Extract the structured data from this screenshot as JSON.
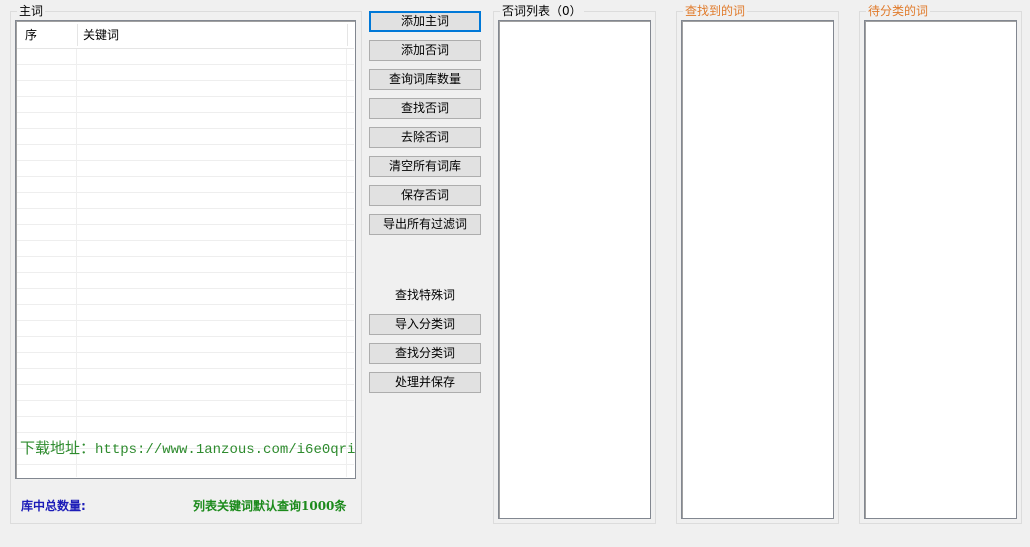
{
  "main_group": {
    "title": "主词",
    "columns": [
      "序",
      "关键词"
    ],
    "download_label": "下载地址：",
    "download_url": "https://www.1anzous.com/i6e0qri",
    "total_label": "库中总数量:",
    "hint_label": "列表关键词默认查询1000条"
  },
  "buttons": {
    "add_main": "添加主词",
    "add_negative": "添加否词",
    "query_count": "查询词库数量",
    "find_negative": "查找否词",
    "remove_negative": "去除否词",
    "clear_all": "清空所有词库",
    "save_negative": "保存否词",
    "export_filter": "导出所有过滤词",
    "find_special_label": "查找特殊词",
    "import_category": "导入分类词",
    "find_category": "查找分类词",
    "process_save": "处理并保存"
  },
  "negative_group": {
    "title": "否词列表（0）"
  },
  "found_group": {
    "title": "查找到的词"
  },
  "pending_group": {
    "title": "待分类的词"
  },
  "colors": {
    "section_title_accent": "#e07a2a",
    "total_label": "#1c1cb8",
    "hint_label": "#1b8a1b",
    "download_text": "#2e8b2e"
  }
}
